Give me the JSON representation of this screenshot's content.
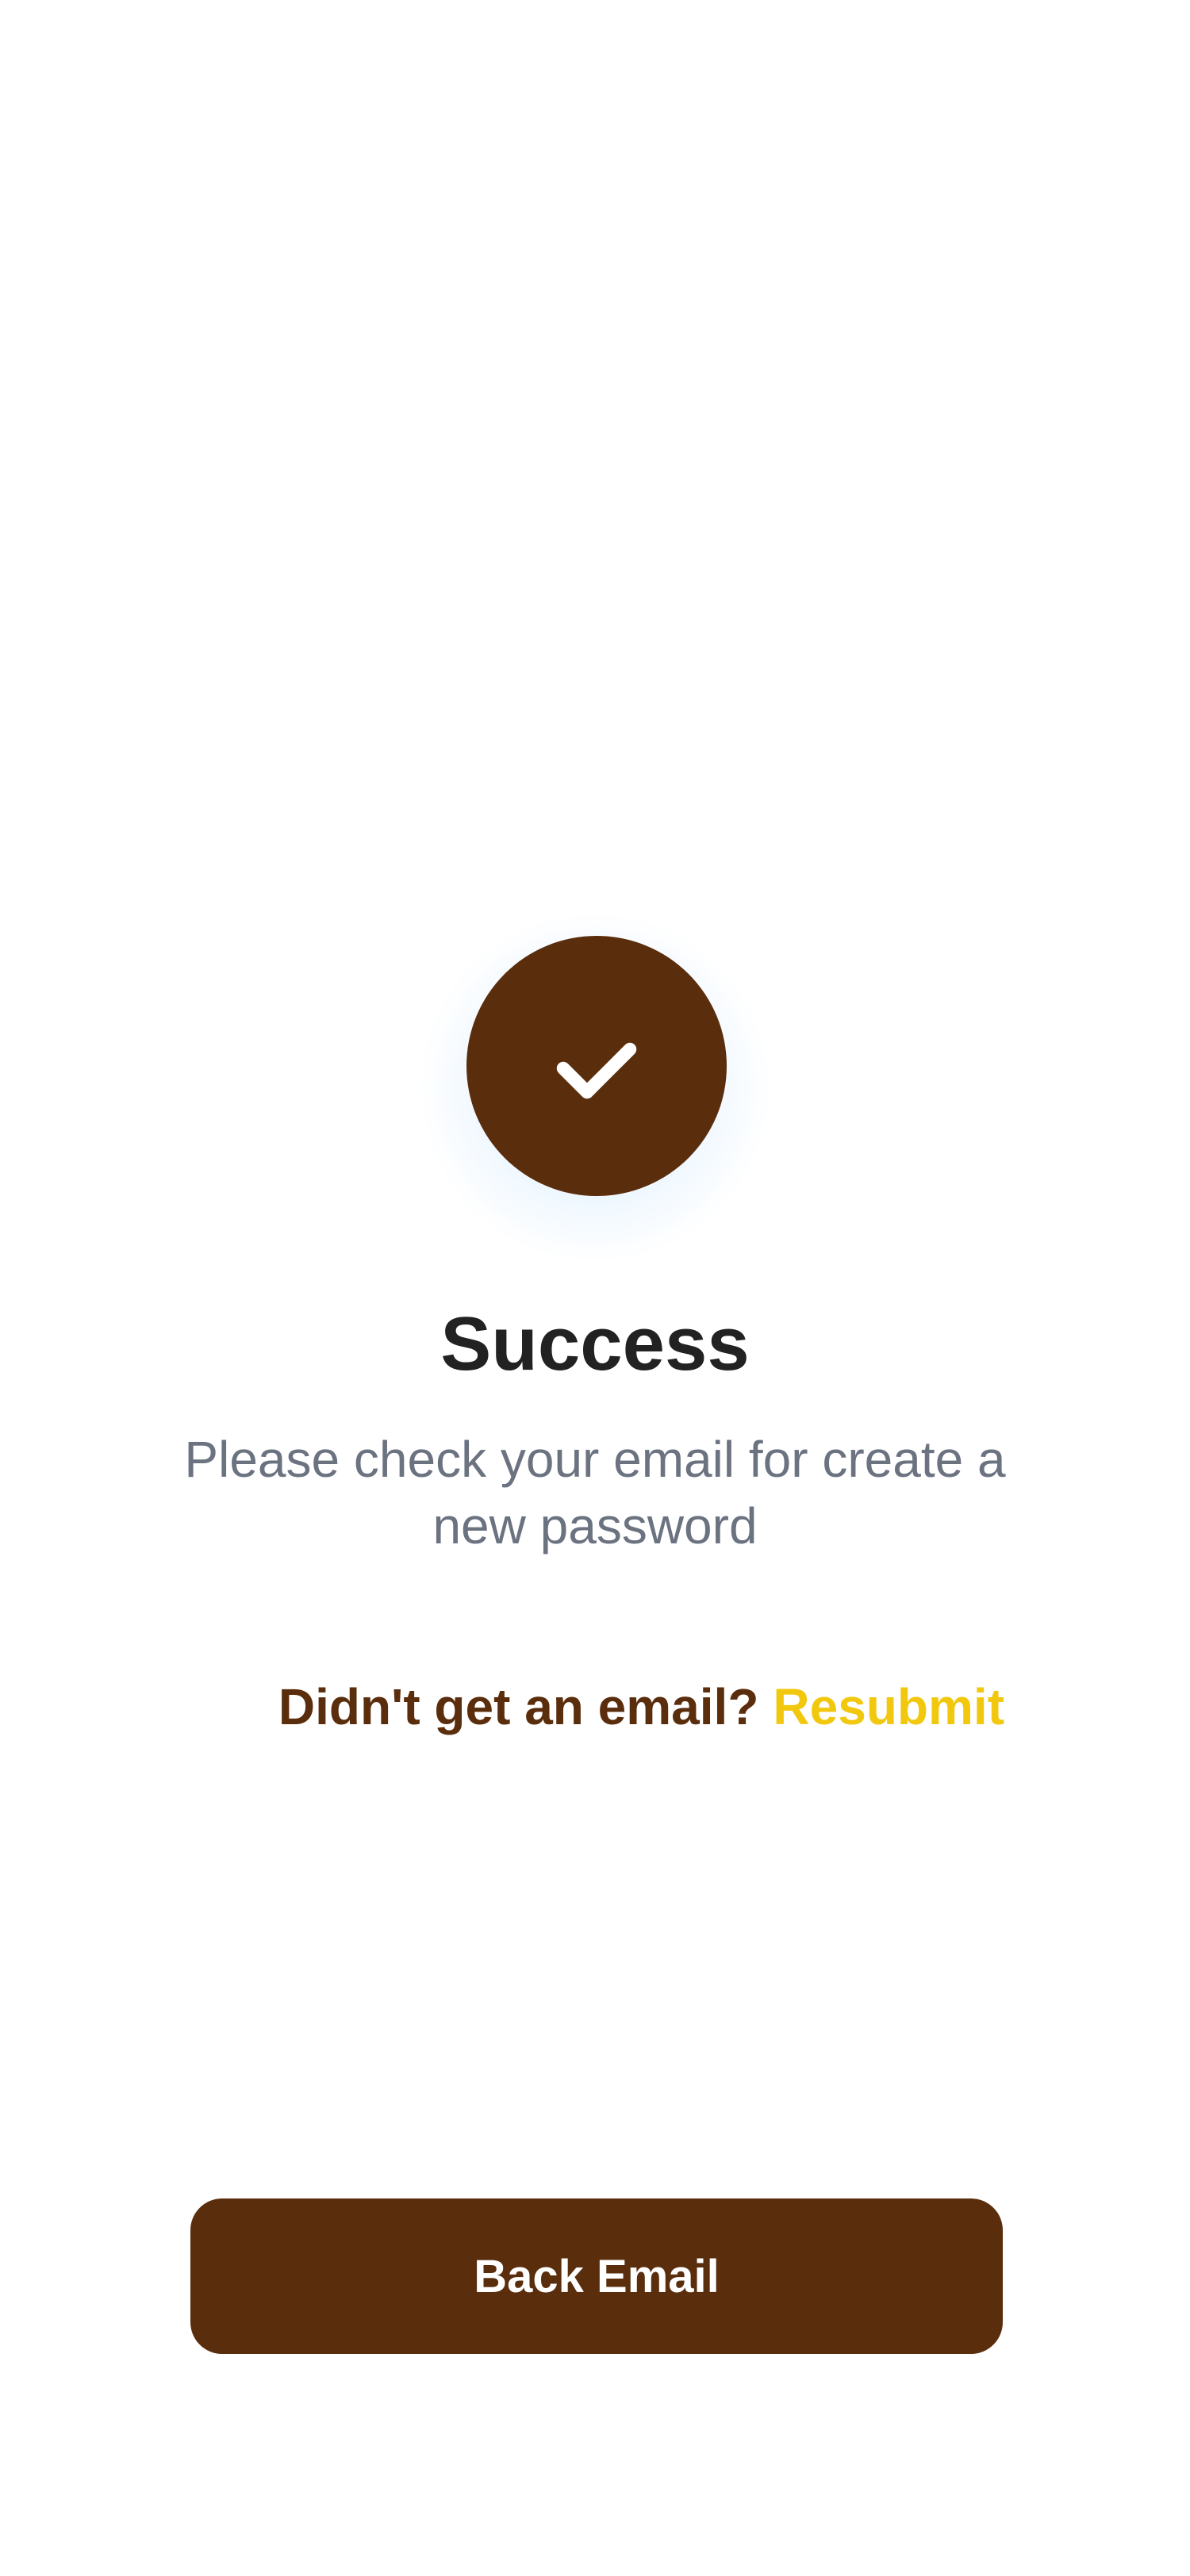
{
  "colors": {
    "background": "#FFFFFF",
    "brand_brown": "#5A2D0C",
    "accent_yellow": "#F2C80F",
    "title_text": "#222222",
    "body_text": "#6B7280",
    "glow": "#CDE8FF"
  },
  "success": {
    "icon": "check-icon",
    "title": "Success",
    "message": "Please check your email for create a new password"
  },
  "resend": {
    "question": "Didn't get an email?",
    "link_label": "Resubmit"
  },
  "actions": {
    "back_label": "Back Email"
  }
}
